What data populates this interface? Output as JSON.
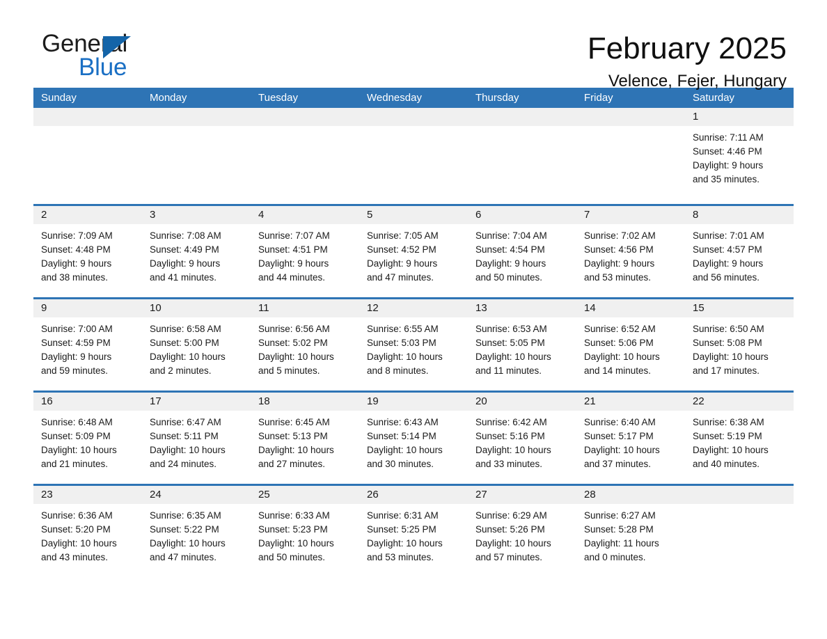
{
  "logo": {
    "word_one": "General",
    "word_two": "Blue",
    "triangle_color": "#1464a8",
    "blue_color": "#1a6fc4"
  },
  "header": {
    "title": "February 2025",
    "subtitle": "Velence, Fejer, Hungary"
  },
  "theme": {
    "header_blue": "#2e74b5",
    "row_band": "#f0f0f0",
    "text": "#1a1a1a"
  },
  "weekdays": [
    "Sunday",
    "Monday",
    "Tuesday",
    "Wednesday",
    "Thursday",
    "Friday",
    "Saturday"
  ],
  "weeks": [
    [
      {
        "day": "",
        "sunrise": "",
        "sunset": "",
        "daylight_line1": "",
        "daylight_line2": ""
      },
      {
        "day": "",
        "sunrise": "",
        "sunset": "",
        "daylight_line1": "",
        "daylight_line2": ""
      },
      {
        "day": "",
        "sunrise": "",
        "sunset": "",
        "daylight_line1": "",
        "daylight_line2": ""
      },
      {
        "day": "",
        "sunrise": "",
        "sunset": "",
        "daylight_line1": "",
        "daylight_line2": ""
      },
      {
        "day": "",
        "sunrise": "",
        "sunset": "",
        "daylight_line1": "",
        "daylight_line2": ""
      },
      {
        "day": "",
        "sunrise": "",
        "sunset": "",
        "daylight_line1": "",
        "daylight_line2": ""
      },
      {
        "day": "1",
        "sunrise": "Sunrise: 7:11 AM",
        "sunset": "Sunset: 4:46 PM",
        "daylight_line1": "Daylight: 9 hours",
        "daylight_line2": "and 35 minutes."
      }
    ],
    [
      {
        "day": "2",
        "sunrise": "Sunrise: 7:09 AM",
        "sunset": "Sunset: 4:48 PM",
        "daylight_line1": "Daylight: 9 hours",
        "daylight_line2": "and 38 minutes."
      },
      {
        "day": "3",
        "sunrise": "Sunrise: 7:08 AM",
        "sunset": "Sunset: 4:49 PM",
        "daylight_line1": "Daylight: 9 hours",
        "daylight_line2": "and 41 minutes."
      },
      {
        "day": "4",
        "sunrise": "Sunrise: 7:07 AM",
        "sunset": "Sunset: 4:51 PM",
        "daylight_line1": "Daylight: 9 hours",
        "daylight_line2": "and 44 minutes."
      },
      {
        "day": "5",
        "sunrise": "Sunrise: 7:05 AM",
        "sunset": "Sunset: 4:52 PM",
        "daylight_line1": "Daylight: 9 hours",
        "daylight_line2": "and 47 minutes."
      },
      {
        "day": "6",
        "sunrise": "Sunrise: 7:04 AM",
        "sunset": "Sunset: 4:54 PM",
        "daylight_line1": "Daylight: 9 hours",
        "daylight_line2": "and 50 minutes."
      },
      {
        "day": "7",
        "sunrise": "Sunrise: 7:02 AM",
        "sunset": "Sunset: 4:56 PM",
        "daylight_line1": "Daylight: 9 hours",
        "daylight_line2": "and 53 minutes."
      },
      {
        "day": "8",
        "sunrise": "Sunrise: 7:01 AM",
        "sunset": "Sunset: 4:57 PM",
        "daylight_line1": "Daylight: 9 hours",
        "daylight_line2": "and 56 minutes."
      }
    ],
    [
      {
        "day": "9",
        "sunrise": "Sunrise: 7:00 AM",
        "sunset": "Sunset: 4:59 PM",
        "daylight_line1": "Daylight: 9 hours",
        "daylight_line2": "and 59 minutes."
      },
      {
        "day": "10",
        "sunrise": "Sunrise: 6:58 AM",
        "sunset": "Sunset: 5:00 PM",
        "daylight_line1": "Daylight: 10 hours",
        "daylight_line2": "and 2 minutes."
      },
      {
        "day": "11",
        "sunrise": "Sunrise: 6:56 AM",
        "sunset": "Sunset: 5:02 PM",
        "daylight_line1": "Daylight: 10 hours",
        "daylight_line2": "and 5 minutes."
      },
      {
        "day": "12",
        "sunrise": "Sunrise: 6:55 AM",
        "sunset": "Sunset: 5:03 PM",
        "daylight_line1": "Daylight: 10 hours",
        "daylight_line2": "and 8 minutes."
      },
      {
        "day": "13",
        "sunrise": "Sunrise: 6:53 AM",
        "sunset": "Sunset: 5:05 PM",
        "daylight_line1": "Daylight: 10 hours",
        "daylight_line2": "and 11 minutes."
      },
      {
        "day": "14",
        "sunrise": "Sunrise: 6:52 AM",
        "sunset": "Sunset: 5:06 PM",
        "daylight_line1": "Daylight: 10 hours",
        "daylight_line2": "and 14 minutes."
      },
      {
        "day": "15",
        "sunrise": "Sunrise: 6:50 AM",
        "sunset": "Sunset: 5:08 PM",
        "daylight_line1": "Daylight: 10 hours",
        "daylight_line2": "and 17 minutes."
      }
    ],
    [
      {
        "day": "16",
        "sunrise": "Sunrise: 6:48 AM",
        "sunset": "Sunset: 5:09 PM",
        "daylight_line1": "Daylight: 10 hours",
        "daylight_line2": "and 21 minutes."
      },
      {
        "day": "17",
        "sunrise": "Sunrise: 6:47 AM",
        "sunset": "Sunset: 5:11 PM",
        "daylight_line1": "Daylight: 10 hours",
        "daylight_line2": "and 24 minutes."
      },
      {
        "day": "18",
        "sunrise": "Sunrise: 6:45 AM",
        "sunset": "Sunset: 5:13 PM",
        "daylight_line1": "Daylight: 10 hours",
        "daylight_line2": "and 27 minutes."
      },
      {
        "day": "19",
        "sunrise": "Sunrise: 6:43 AM",
        "sunset": "Sunset: 5:14 PM",
        "daylight_line1": "Daylight: 10 hours",
        "daylight_line2": "and 30 minutes."
      },
      {
        "day": "20",
        "sunrise": "Sunrise: 6:42 AM",
        "sunset": "Sunset: 5:16 PM",
        "daylight_line1": "Daylight: 10 hours",
        "daylight_line2": "and 33 minutes."
      },
      {
        "day": "21",
        "sunrise": "Sunrise: 6:40 AM",
        "sunset": "Sunset: 5:17 PM",
        "daylight_line1": "Daylight: 10 hours",
        "daylight_line2": "and 37 minutes."
      },
      {
        "day": "22",
        "sunrise": "Sunrise: 6:38 AM",
        "sunset": "Sunset: 5:19 PM",
        "daylight_line1": "Daylight: 10 hours",
        "daylight_line2": "and 40 minutes."
      }
    ],
    [
      {
        "day": "23",
        "sunrise": "Sunrise: 6:36 AM",
        "sunset": "Sunset: 5:20 PM",
        "daylight_line1": "Daylight: 10 hours",
        "daylight_line2": "and 43 minutes."
      },
      {
        "day": "24",
        "sunrise": "Sunrise: 6:35 AM",
        "sunset": "Sunset: 5:22 PM",
        "daylight_line1": "Daylight: 10 hours",
        "daylight_line2": "and 47 minutes."
      },
      {
        "day": "25",
        "sunrise": "Sunrise: 6:33 AM",
        "sunset": "Sunset: 5:23 PM",
        "daylight_line1": "Daylight: 10 hours",
        "daylight_line2": "and 50 minutes."
      },
      {
        "day": "26",
        "sunrise": "Sunrise: 6:31 AM",
        "sunset": "Sunset: 5:25 PM",
        "daylight_line1": "Daylight: 10 hours",
        "daylight_line2": "and 53 minutes."
      },
      {
        "day": "27",
        "sunrise": "Sunrise: 6:29 AM",
        "sunset": "Sunset: 5:26 PM",
        "daylight_line1": "Daylight: 10 hours",
        "daylight_line2": "and 57 minutes."
      },
      {
        "day": "28",
        "sunrise": "Sunrise: 6:27 AM",
        "sunset": "Sunset: 5:28 PM",
        "daylight_line1": "Daylight: 11 hours",
        "daylight_line2": "and 0 minutes."
      },
      {
        "day": "",
        "sunrise": "",
        "sunset": "",
        "daylight_line1": "",
        "daylight_line2": ""
      }
    ]
  ]
}
